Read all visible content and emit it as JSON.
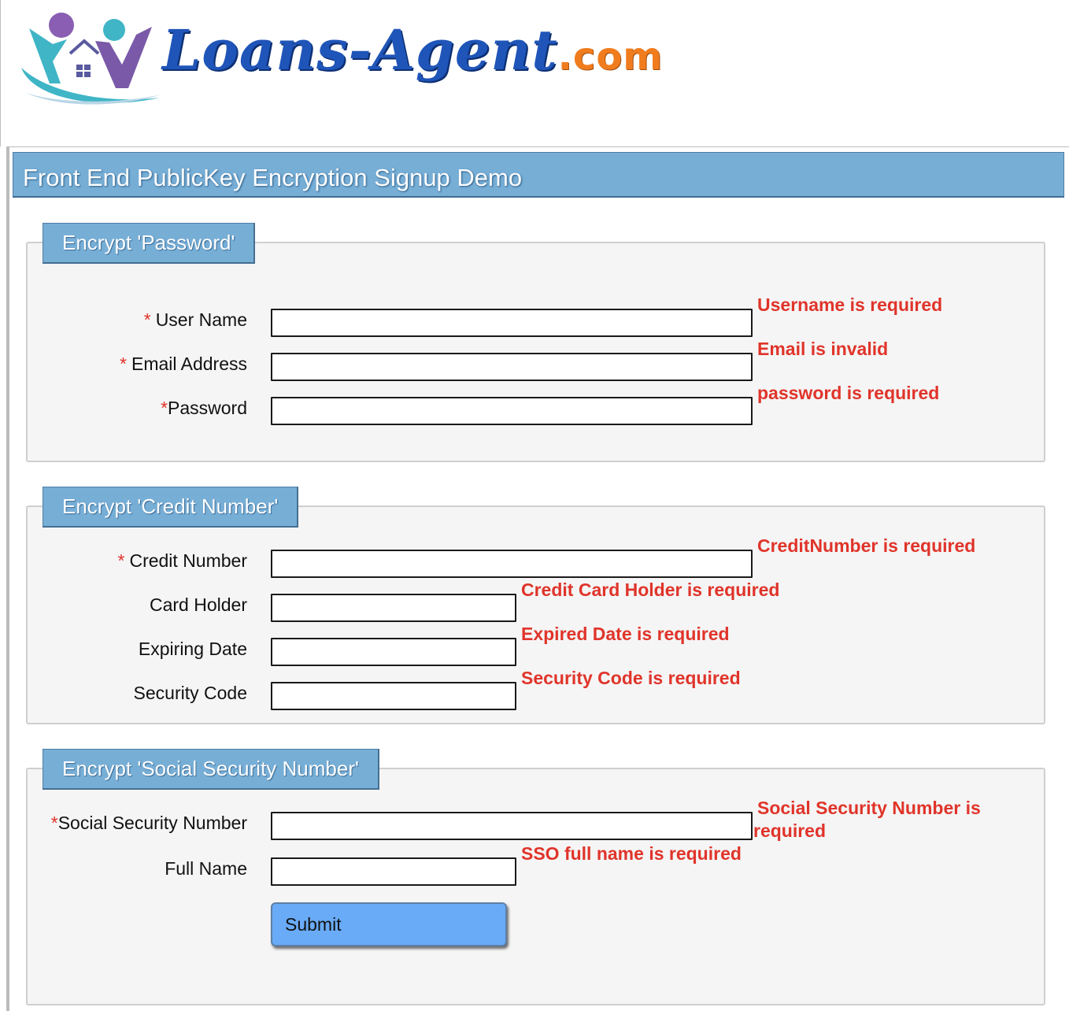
{
  "brand": {
    "logo_text": "Loans-Agent",
    "logo_suffix": ".com",
    "colors": {
      "primary": "#1f55b8",
      "accent": "#f07c1e",
      "teal": "#3fb5c6",
      "purple": "#7a5aa8"
    }
  },
  "page_title": "Front End PublicKey Encryption Signup Demo",
  "colors": {
    "header_blue": "#77aed6",
    "error_red": "#e0342a",
    "button_blue": "#69abf7"
  },
  "sections": {
    "password": {
      "legend": "Encrypt 'Password'",
      "fields": {
        "username": {
          "required_mark": "*",
          "label": "User Name",
          "value": "",
          "error": "Username is required"
        },
        "email": {
          "required_mark": "*",
          "label": "Email Address",
          "value": "",
          "error": "Email is invalid"
        },
        "password": {
          "required_mark": "*",
          "label": "Password",
          "value": "",
          "error": "password is required"
        }
      }
    },
    "credit": {
      "legend": "Encrypt 'Credit Number'",
      "fields": {
        "credit_number": {
          "required_mark": "*",
          "label": "Credit Number",
          "value": "",
          "error": "CreditNumber is required"
        },
        "card_holder": {
          "label": "Card Holder",
          "value": "",
          "error": "Credit Card Holder is required"
        },
        "expiring_date": {
          "label": "Expiring Date",
          "value": "",
          "error": "Expired Date is required"
        },
        "security_code": {
          "label": "Security Code",
          "value": "",
          "error": "Security Code is required"
        }
      }
    },
    "ssn": {
      "legend": "Encrypt 'Social Security Number'",
      "fields": {
        "ssn": {
          "required_mark": "*",
          "label": "Social Security Number",
          "value": "",
          "error_line1": "Social Security Number is",
          "error_line2": "required"
        },
        "full_name": {
          "label": "Full Name",
          "value": "",
          "error": "SSO full name is required"
        }
      },
      "submit_label": "Submit"
    }
  }
}
